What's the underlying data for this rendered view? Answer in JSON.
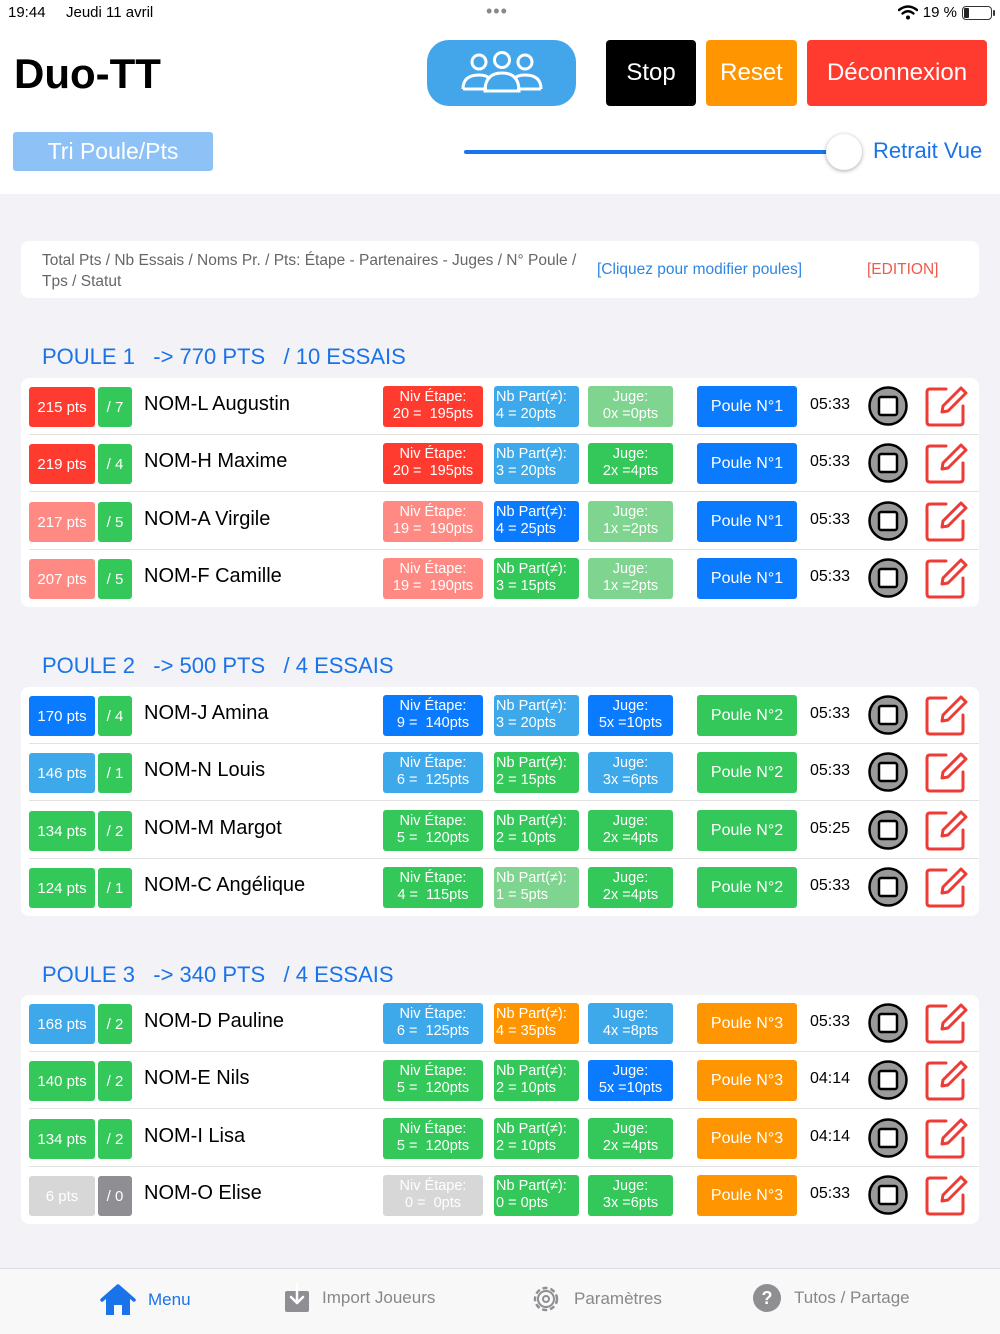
{
  "status": {
    "time": "19:44",
    "date": "Jeudi 11 avril",
    "battery": "19 %"
  },
  "app": {
    "title": "Duo-TT"
  },
  "toolbar": {
    "stop": "Stop",
    "reset": "Reset",
    "logout": "Déconnexion",
    "sort": "Tri Poule/Pts",
    "retrait": "Retrait Vue",
    "slider_value": 1.0
  },
  "info": {
    "text": "Total Pts / Nb Essais / Noms Pr. / Pts: Étape - Partenaires - Juges / N° Poule / Tps / Statut",
    "link": "[Cliquez pour modifier poules]",
    "edit": "[EDITION]"
  },
  "colors": {
    "red": "#ff3b30",
    "salmon": "#ff8a84",
    "green": "#34c759",
    "lightgreen": "#7fd48f",
    "blue": "#0a7aff",
    "lightblue": "#3ea9ea",
    "orange": "#ff9500",
    "grey": "#d7d7d7",
    "darkgrey": "#8e8e93",
    "pouleBlue": "#0a7aff"
  },
  "pools": [
    {
      "title": "POULE 1   -> 770 PTS   / 10 ESSAIS",
      "players": [
        {
          "pts": "215 pts",
          "tries": "/ 7",
          "name": "NOM-L Augustin",
          "etape": "Niv Étape:\n20 =  195pts",
          "part": "Nb Part(≠):\n4 = 20pts",
          "juge": "Juge:\n0x =0pts",
          "poule": "Poule N°1",
          "time": "05:33",
          "c": [
            "red",
            "green",
            "red",
            "lightblue",
            "lightgreen",
            "pouleBlue"
          ]
        },
        {
          "pts": "219 pts",
          "tries": "/ 4",
          "name": "NOM-H Maxime",
          "etape": "Niv Étape:\n20 =  195pts",
          "part": "Nb Part(≠):\n3 = 20pts",
          "juge": "Juge:\n2x =4pts",
          "poule": "Poule N°1",
          "time": "05:33",
          "c": [
            "red",
            "green",
            "red",
            "lightblue",
            "green",
            "pouleBlue"
          ]
        },
        {
          "pts": "217 pts",
          "tries": "/ 5",
          "name": "NOM-A Virgile",
          "etape": "Niv Étape:\n19 =  190pts",
          "part": "Nb Part(≠):\n4 = 25pts",
          "juge": "Juge:\n1x =2pts",
          "poule": "Poule N°1",
          "time": "05:33",
          "c": [
            "salmon",
            "green",
            "salmon",
            "blue",
            "lightgreen",
            "pouleBlue"
          ]
        },
        {
          "pts": "207 pts",
          "tries": "/ 5",
          "name": "NOM-F Camille",
          "etape": "Niv Étape:\n19 =  190pts",
          "part": "Nb Part(≠):\n3 = 15pts",
          "juge": "Juge:\n1x =2pts",
          "poule": "Poule N°1",
          "time": "05:33",
          "c": [
            "salmon",
            "green",
            "salmon",
            "green",
            "lightgreen",
            "pouleBlue"
          ]
        }
      ]
    },
    {
      "title": "POULE 2   -> 500 PTS   / 4 ESSAIS",
      "players": [
        {
          "pts": "170 pts",
          "tries": "/ 4",
          "name": "NOM-J Amina",
          "etape": "Niv Étape:\n9 =  140pts",
          "part": "Nb Part(≠):\n3 = 20pts",
          "juge": "Juge:\n5x =10pts",
          "poule": "Poule N°2",
          "time": "05:33",
          "c": [
            "blue",
            "green",
            "blue",
            "lightblue",
            "blue",
            "green"
          ]
        },
        {
          "pts": "146 pts",
          "tries": "/ 1",
          "name": "NOM-N Louis",
          "etape": "Niv Étape:\n6 =  125pts",
          "part": "Nb Part(≠):\n2 = 15pts",
          "juge": "Juge:\n3x =6pts",
          "poule": "Poule N°2",
          "time": "05:33",
          "c": [
            "lightblue",
            "green",
            "lightblue",
            "green",
            "lightblue",
            "green"
          ]
        },
        {
          "pts": "134 pts",
          "tries": "/ 2",
          "name": "NOM-M Margot",
          "etape": "Niv Étape:\n5 =  120pts",
          "part": "Nb Part(≠):\n2 = 10pts",
          "juge": "Juge:\n2x =4pts",
          "poule": "Poule N°2",
          "time": "05:25",
          "c": [
            "green",
            "green",
            "green",
            "green",
            "green",
            "green"
          ]
        },
        {
          "pts": "124 pts",
          "tries": "/ 1",
          "name": "NOM-C Angélique",
          "etape": "Niv Étape:\n4 =  115pts",
          "part": "Nb Part(≠):\n1 = 5pts",
          "juge": "Juge:\n2x =4pts",
          "poule": "Poule N°2",
          "time": "05:33",
          "c": [
            "green",
            "green",
            "green",
            "lightgreen",
            "green",
            "green"
          ]
        }
      ]
    },
    {
      "title": "POULE 3   -> 340 PTS   / 4 ESSAIS",
      "players": [
        {
          "pts": "168 pts",
          "tries": "/ 2",
          "name": "NOM-D Pauline",
          "etape": "Niv Étape:\n6 =  125pts",
          "part": "Nb Part(≠):\n4 = 35pts",
          "juge": "Juge:\n4x =8pts",
          "poule": "Poule N°3",
          "time": "05:33",
          "c": [
            "lightblue",
            "green",
            "lightblue",
            "orange",
            "lightblue",
            "orange"
          ]
        },
        {
          "pts": "140 pts",
          "tries": "/ 2",
          "name": "NOM-E Nils",
          "etape": "Niv Étape:\n5 =  120pts",
          "part": "Nb Part(≠):\n2 = 10pts",
          "juge": "Juge:\n5x =10pts",
          "poule": "Poule N°3",
          "time": "04:14",
          "c": [
            "green",
            "green",
            "green",
            "green",
            "blue",
            "orange"
          ]
        },
        {
          "pts": "134 pts",
          "tries": "/ 2",
          "name": "NOM-I Lisa",
          "etape": "Niv Étape:\n5 =  120pts",
          "part": "Nb Part(≠):\n2 = 10pts",
          "juge": "Juge:\n2x =4pts",
          "poule": "Poule N°3",
          "time": "04:14",
          "c": [
            "green",
            "green",
            "green",
            "green",
            "green",
            "orange"
          ]
        },
        {
          "pts": "6 pts",
          "tries": "/ 0",
          "name": "NOM-O Elise",
          "etape": "Niv Étape:\n0 =  0pts",
          "part": "Nb Part(≠):\n0 = 0pts",
          "juge": "Juge:\n3x =6pts",
          "poule": "Poule N°3",
          "time": "05:33",
          "c": [
            "grey",
            "darkgrey",
            "grey",
            "green",
            "green",
            "orange"
          ]
        }
      ]
    }
  ],
  "tabs": {
    "menu": "Menu",
    "import": "Import Joueurs",
    "settings": "Paramètres",
    "tutos": "Tutos / Partage"
  },
  "icons": {
    "group": "group-icon",
    "stop": "stop-square-icon",
    "edit": "edit-icon",
    "home": "home-icon",
    "download": "download-icon",
    "gear": "gear-icon",
    "help": "help-icon",
    "wifi": "wifi-icon",
    "battery": "battery-icon"
  }
}
